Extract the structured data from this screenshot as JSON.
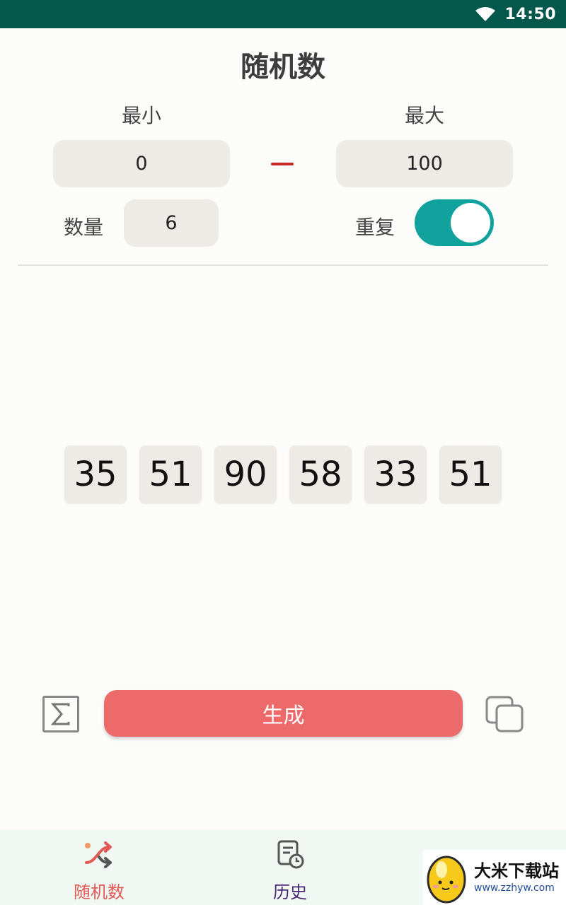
{
  "status_bar": {
    "time": "14:50",
    "wifi_icon": "wifi-icon"
  },
  "page": {
    "title": "随机数"
  },
  "range": {
    "min_label": "最小",
    "min_value": "0",
    "max_label": "最大",
    "max_value": "100"
  },
  "count": {
    "label": "数量",
    "value": "6"
  },
  "repeat": {
    "label": "重复",
    "enabled": true
  },
  "results": [
    "35",
    "51",
    "90",
    "58",
    "33",
    "51"
  ],
  "actions": {
    "sum_icon": "sigma-icon",
    "generate_label": "生成",
    "copy_icon": "copy-icon"
  },
  "bottom_nav": {
    "items": [
      {
        "label": "随机数",
        "icon": "shuffle-icon",
        "active": true
      },
      {
        "label": "历史",
        "icon": "history-icon",
        "active": false
      }
    ]
  },
  "watermark": {
    "name": "大米下载站",
    "url": "www.zzhyw.com"
  },
  "colors": {
    "status_bar": "#03584b",
    "accent_red": "#ec6a6a",
    "toggle_on": "#12a29e",
    "pill_bg": "#eeebe6",
    "dash": "#d0242b"
  }
}
